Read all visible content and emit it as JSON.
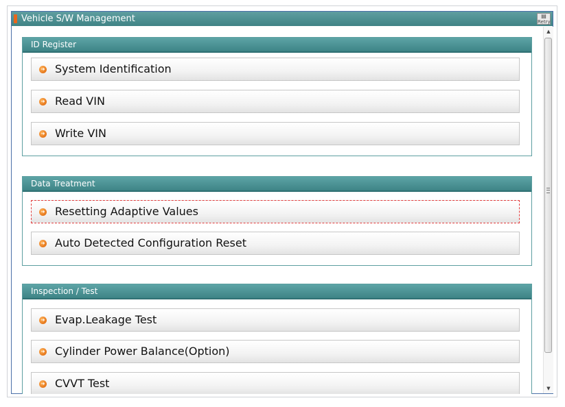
{
  "window": {
    "title": "Vehicle S/W Management",
    "retry_label": "Retry"
  },
  "groups": [
    {
      "header": "ID Register",
      "items": [
        {
          "label": "System Identification"
        },
        {
          "label": "Read VIN"
        },
        {
          "label": "Write VIN"
        }
      ]
    },
    {
      "header": "Data Treatment",
      "items": [
        {
          "label": "Resetting Adaptive Values",
          "focused": true
        },
        {
          "label": "Auto Detected Configuration Reset"
        }
      ]
    },
    {
      "header": "Inspection / Test",
      "items": [
        {
          "label": "Evap.Leakage Test"
        },
        {
          "label": "Cylinder Power Balance(Option)"
        },
        {
          "label": "CVVT Test"
        }
      ]
    }
  ],
  "colors": {
    "header_teal": "#4a9496",
    "bullet_orange": "#f08a24",
    "focus_outline": "#e23b3b"
  }
}
